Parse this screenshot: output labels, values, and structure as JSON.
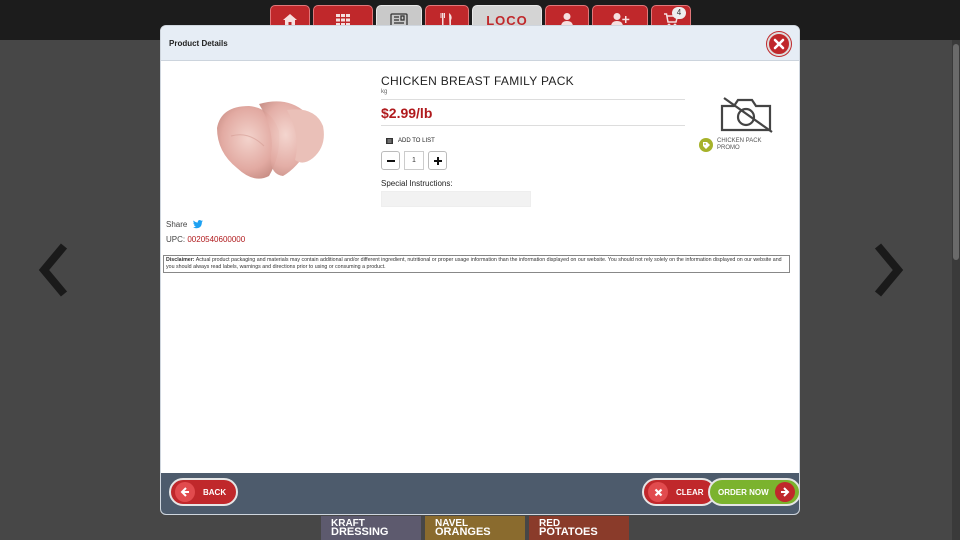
{
  "nav": {
    "tabs": [
      {
        "icon": "home-icon"
      },
      {
        "icon": "grid-icon"
      },
      {
        "icon": "newspaper-icon"
      },
      {
        "icon": "restaurant-icon"
      },
      {
        "icon": "loco-logo"
      },
      {
        "icon": "user-icon"
      },
      {
        "icon": "add-user-icon"
      },
      {
        "icon": "cart-icon"
      }
    ],
    "logo_text": "LOCO",
    "cart_count": "4"
  },
  "modal": {
    "title": "Product Details",
    "product": {
      "name": "CHICKEN BREAST FAMILY PACK",
      "unit": "kg",
      "price": "$2.99/lb",
      "add_to_list": "ADD TO LIST",
      "quantity": "1",
      "special_instructions_label": "Special Instructions:",
      "special_instructions_value": "",
      "promo_tag": "CHICKEN PACK PROMO"
    },
    "share_label": "Share",
    "upc_label": "UPC:",
    "upc_value": "0020540600000",
    "disclaimer_label": "Disclaimer:",
    "disclaimer_text": "Actual product packaging and materials may contain additional and/or different ingredient, nutritional or proper usage information than the information displayed on our website. You should not rely solely on the information displayed on our website and you should always read labels, warnings and directions prior to using or consuming a product.",
    "footer": {
      "back_label": "BACK",
      "clear_label": "CLEAR",
      "order_label": "ORDER NOW"
    }
  },
  "background": {
    "promos": [
      {
        "line1": "KRAFT",
        "line2": "DRESSING"
      },
      {
        "line1": "NAVEL",
        "line2": "ORANGES"
      },
      {
        "line1": "RED",
        "line2": "POTATOES"
      }
    ]
  },
  "colors": {
    "accent_red": "#c0282b",
    "price_red": "#b01a1d",
    "order_green": "#7bb32e",
    "footer_slate": "#4d5b6c"
  }
}
